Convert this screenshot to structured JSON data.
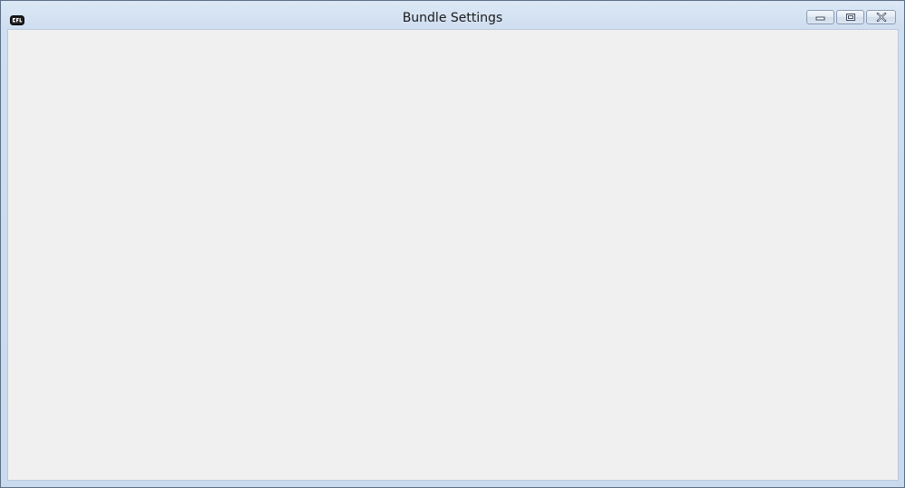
{
  "window": {
    "title": "Bundle Settings",
    "app_icon": "app-logo-icon",
    "caption_buttons": [
      {
        "name": "minimize",
        "icon": "minimize-icon"
      },
      {
        "name": "maximize",
        "icon": "maximize-icon"
      },
      {
        "name": "close",
        "icon": "close-icon"
      }
    ]
  },
  "colors": {
    "frame": "#cfdef0",
    "client_background": "#f0f0f0",
    "title_text": "#1a1a1a"
  }
}
